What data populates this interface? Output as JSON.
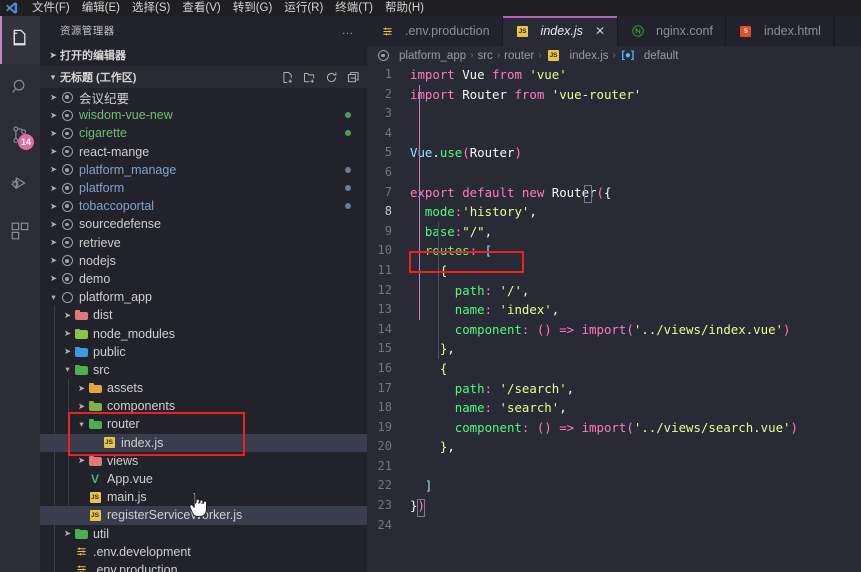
{
  "menu": {
    "logo_icon": "vscode-logo-icon",
    "items": [
      "文件(F)",
      "编辑(E)",
      "选择(S)",
      "查看(V)",
      "转到(G)",
      "运行(R)",
      "终端(T)",
      "帮助(H)"
    ]
  },
  "activitybar": {
    "items": [
      {
        "name": "explorer",
        "icon": "files-icon",
        "active": true,
        "badge": ""
      },
      {
        "name": "search",
        "icon": "search-icon",
        "active": false,
        "badge": ""
      },
      {
        "name": "source-control",
        "icon": "source-control-icon",
        "active": false,
        "badge": "14"
      },
      {
        "name": "run-debug",
        "icon": "run-and-debug-icon",
        "active": false,
        "badge": ""
      },
      {
        "name": "extensions",
        "icon": "extensions-icon",
        "active": false,
        "badge": ""
      }
    ]
  },
  "sidebar": {
    "title": "资源管理器",
    "more_actions": "…",
    "open_editors_label": "打开的编辑器",
    "workspace_label": "无标题 (工作区)",
    "actions": [
      "new-file-icon",
      "new-folder-icon",
      "refresh-icon",
      "collapse-all-icon"
    ],
    "tree": [
      {
        "label": "会议纪要",
        "depth": 1,
        "icon": "git-repo-icon",
        "chevron": "collapsed",
        "badge": ""
      },
      {
        "label": "wisdom-vue-new",
        "depth": 1,
        "icon": "git-repo-icon",
        "chevron": "collapsed",
        "badge": "#4a9e52",
        "color": "#6fbf73"
      },
      {
        "label": "cigarette",
        "depth": 1,
        "icon": "git-repo-icon",
        "chevron": "collapsed",
        "badge": "#4a9e52",
        "color": "#6fbf73"
      },
      {
        "label": "react-mange",
        "depth": 1,
        "icon": "git-repo-icon",
        "chevron": "collapsed",
        "badge": ""
      },
      {
        "label": "platform_manage",
        "depth": 1,
        "icon": "git-repo-icon",
        "chevron": "collapsed",
        "badge": "#6b7d94",
        "color": "#7fa3cc"
      },
      {
        "label": "platform",
        "depth": 1,
        "icon": "git-repo-icon",
        "chevron": "collapsed",
        "badge": "#6b7d94",
        "color": "#7fa3cc"
      },
      {
        "label": "tobaccoportal",
        "depth": 1,
        "icon": "git-repo-icon",
        "chevron": "collapsed",
        "badge": "#6b7d94",
        "color": "#7fa3cc"
      },
      {
        "label": "sourcedefense",
        "depth": 1,
        "icon": "git-repo-icon",
        "chevron": "collapsed",
        "badge": ""
      },
      {
        "label": "retrieve",
        "depth": 1,
        "icon": "git-repo-icon",
        "chevron": "collapsed",
        "badge": ""
      },
      {
        "label": "nodejs",
        "depth": 1,
        "icon": "git-repo-icon",
        "chevron": "collapsed",
        "badge": ""
      },
      {
        "label": "demo",
        "depth": 1,
        "icon": "git-repo-icon",
        "chevron": "collapsed",
        "badge": ""
      },
      {
        "label": "platform_app",
        "depth": 1,
        "icon": "open-circle-icon",
        "chevron": "expanded",
        "badge": ""
      },
      {
        "label": "dist",
        "depth": 2,
        "icon": "folder-icon",
        "folder_color": "#e07a7a",
        "chevron": "collapsed",
        "badge": ""
      },
      {
        "label": "node_modules",
        "depth": 2,
        "icon": "folder-icon",
        "folder_color": "#8bc34a",
        "chevron": "collapsed",
        "badge": ""
      },
      {
        "label": "public",
        "depth": 2,
        "icon": "folder-icon",
        "folder_color": "#3b9ae1",
        "chevron": "collapsed",
        "badge": ""
      },
      {
        "label": "src",
        "depth": 2,
        "icon": "folder-icon",
        "folder_color": "#4caf50",
        "chevron": "expanded",
        "badge": ""
      },
      {
        "label": "assets",
        "depth": 3,
        "icon": "folder-icon",
        "folder_color": "#e8a33d",
        "chevron": "collapsed",
        "badge": ""
      },
      {
        "label": "components",
        "depth": 3,
        "icon": "folder-icon",
        "folder_color": "#7cb342",
        "chevron": "collapsed",
        "badge": ""
      },
      {
        "label": "router",
        "depth": 3,
        "icon": "folder-icon",
        "folder_color": "#4caf50",
        "chevron": "expanded",
        "badge": ""
      },
      {
        "label": "index.js",
        "depth": 4,
        "icon": "js-file-icon",
        "chevron": "none",
        "badge": "",
        "selected": true
      },
      {
        "label": "views",
        "depth": 3,
        "icon": "folder-icon",
        "folder_color": "#e07a7a",
        "chevron": "collapsed",
        "badge": ""
      },
      {
        "label": "App.vue",
        "depth": 3,
        "icon": "vue-file-icon",
        "chevron": "none",
        "badge": ""
      },
      {
        "label": "main.js",
        "depth": 3,
        "icon": "js-file-icon",
        "chevron": "none",
        "badge": ""
      },
      {
        "label": "registerServiceWorker.js",
        "depth": 3,
        "icon": "js-file-icon",
        "chevron": "none",
        "badge": "",
        "hovered": true
      },
      {
        "label": "util",
        "depth": 2,
        "icon": "folder-icon",
        "folder_color": "#4caf50",
        "chevron": "collapsed",
        "badge": ""
      },
      {
        "label": ".env.development",
        "depth": 2,
        "icon": "settings-file-icon",
        "chevron": "none",
        "badge": ""
      },
      {
        "label": ".env.production",
        "depth": 2,
        "icon": "settings-file-icon",
        "chevron": "none",
        "badge": ""
      }
    ],
    "highlight_box_label": "router-index-js-highlight"
  },
  "editor": {
    "tabs": [
      {
        "label": ".env.production",
        "icon": "settings-file-icon",
        "active": false,
        "closable": false
      },
      {
        "label": "index.js",
        "icon": "js-file-icon",
        "active": true,
        "closable": true,
        "close_glyph": "✕"
      },
      {
        "label": "nginx.conf",
        "icon": "nginx-file-icon",
        "active": false,
        "closable": false
      },
      {
        "label": "index.html",
        "icon": "html-file-icon",
        "active": false,
        "closable": false
      }
    ],
    "breadcrumb": [
      {
        "label": "platform_app",
        "icon": "git-repo-icon"
      },
      {
        "label": "src",
        "icon": ""
      },
      {
        "label": "router",
        "icon": ""
      },
      {
        "label": "index.js",
        "icon": "js-file-icon"
      },
      {
        "label": "default",
        "icon": "symbol-default-icon"
      }
    ],
    "breadcrumb_separator": "›",
    "highlight_box_label": "base-line-highlight",
    "lines": [
      {
        "n": 1,
        "tokens": [
          {
            "t": "import ",
            "c": "t-kw"
          },
          {
            "t": "Vue ",
            "c": "t-plain"
          },
          {
            "t": "from ",
            "c": "t-kw"
          },
          {
            "t": "'vue'",
            "c": "t-str"
          }
        ]
      },
      {
        "n": 2,
        "tokens": [
          {
            "t": "import ",
            "c": "t-kw"
          },
          {
            "t": "Router ",
            "c": "t-plain"
          },
          {
            "t": "from ",
            "c": "t-kw"
          },
          {
            "t": "'vue-router'",
            "c": "t-str"
          }
        ]
      },
      {
        "n": 3,
        "tokens": []
      },
      {
        "n": 4,
        "tokens": []
      },
      {
        "n": 5,
        "tokens": [
          {
            "t": "Vue",
            "c": "t-cls"
          },
          {
            "t": ".",
            "c": "t-plain"
          },
          {
            "t": "use",
            "c": "t-fn"
          },
          {
            "t": "(",
            "c": "t-pun"
          },
          {
            "t": "Router",
            "c": "t-plain"
          },
          {
            "t": ")",
            "c": "t-pun"
          }
        ]
      },
      {
        "n": 6,
        "tokens": []
      },
      {
        "n": 7,
        "tokens": [
          {
            "t": "export default ",
            "c": "t-kw"
          },
          {
            "t": "new ",
            "c": "t-kw"
          },
          {
            "t": "Router",
            "c": "t-plain"
          },
          {
            "t": "(",
            "c": "t-pun"
          },
          {
            "t": "{",
            "c": "t-plain"
          }
        ]
      },
      {
        "n": 8,
        "tokens": [
          {
            "t": "  mode",
            "c": "t-prop"
          },
          {
            "t": ":",
            "c": "t-pun"
          },
          {
            "t": "'history'",
            "c": "t-str"
          },
          {
            "t": ",",
            "c": "t-plain"
          }
        ]
      },
      {
        "n": 9,
        "tokens": [
          {
            "t": "  base",
            "c": "t-prop"
          },
          {
            "t": ":",
            "c": "t-pun"
          },
          {
            "t": "\"/\"",
            "c": "t-str"
          },
          {
            "t": ",",
            "c": "t-plain"
          }
        ]
      },
      {
        "n": 10,
        "tokens": [
          {
            "t": "  routes",
            "c": "t-prop"
          },
          {
            "t": ": ",
            "c": "t-pun"
          },
          {
            "t": "[",
            "c": "t-cls"
          }
        ]
      },
      {
        "n": 11,
        "tokens": [
          {
            "t": "    ",
            "c": "t-plain"
          },
          {
            "t": "{",
            "c": "t-yel"
          }
        ]
      },
      {
        "n": 12,
        "tokens": [
          {
            "t": "      path",
            "c": "t-prop"
          },
          {
            "t": ": ",
            "c": "t-pun"
          },
          {
            "t": "'/'",
            "c": "t-str"
          },
          {
            "t": ",",
            "c": "t-plain"
          }
        ]
      },
      {
        "n": 13,
        "tokens": [
          {
            "t": "      name",
            "c": "t-prop"
          },
          {
            "t": ": ",
            "c": "t-pun"
          },
          {
            "t": "'index'",
            "c": "t-str"
          },
          {
            "t": ",",
            "c": "t-plain"
          }
        ]
      },
      {
        "n": 14,
        "tokens": [
          {
            "t": "      component",
            "c": "t-prop"
          },
          {
            "t": ": ",
            "c": "t-pun"
          },
          {
            "t": "()",
            "c": "t-pun"
          },
          {
            "t": " => ",
            "c": "t-kw"
          },
          {
            "t": "import",
            "c": "t-pun"
          },
          {
            "t": "(",
            "c": "t-pun"
          },
          {
            "t": "'../views/index.vue'",
            "c": "t-str"
          },
          {
            "t": ")",
            "c": "t-pun"
          }
        ]
      },
      {
        "n": 15,
        "tokens": [
          {
            "t": "    ",
            "c": "t-plain"
          },
          {
            "t": "}",
            "c": "t-yel"
          },
          {
            "t": ",",
            "c": "t-plain"
          }
        ]
      },
      {
        "n": 16,
        "tokens": [
          {
            "t": "    ",
            "c": "t-plain"
          },
          {
            "t": "{",
            "c": "t-yel"
          }
        ]
      },
      {
        "n": 17,
        "tokens": [
          {
            "t": "      path",
            "c": "t-prop"
          },
          {
            "t": ": ",
            "c": "t-pun"
          },
          {
            "t": "'/search'",
            "c": "t-str"
          },
          {
            "t": ",",
            "c": "t-plain"
          }
        ]
      },
      {
        "n": 18,
        "tokens": [
          {
            "t": "      name",
            "c": "t-prop"
          },
          {
            "t": ": ",
            "c": "t-pun"
          },
          {
            "t": "'search'",
            "c": "t-str"
          },
          {
            "t": ",",
            "c": "t-plain"
          }
        ]
      },
      {
        "n": 19,
        "tokens": [
          {
            "t": "      component",
            "c": "t-prop"
          },
          {
            "t": ": ",
            "c": "t-pun"
          },
          {
            "t": "()",
            "c": "t-pun"
          },
          {
            "t": " => ",
            "c": "t-kw"
          },
          {
            "t": "import",
            "c": "t-pun"
          },
          {
            "t": "(",
            "c": "t-pun"
          },
          {
            "t": "'../views/search.vue'",
            "c": "t-str"
          },
          {
            "t": ")",
            "c": "t-pun"
          }
        ]
      },
      {
        "n": 20,
        "tokens": [
          {
            "t": "    ",
            "c": "t-plain"
          },
          {
            "t": "}",
            "c": "t-yel"
          },
          {
            "t": ",",
            "c": "t-plain"
          }
        ]
      },
      {
        "n": 21,
        "tokens": []
      },
      {
        "n": 22,
        "tokens": [
          {
            "t": "  ",
            "c": "t-plain"
          },
          {
            "t": "]",
            "c": "t-cls"
          }
        ]
      },
      {
        "n": 23,
        "tokens": [
          {
            "t": "}",
            "c": "t-plain"
          },
          {
            "t": ")",
            "c": "t-pun"
          }
        ]
      },
      {
        "n": 24,
        "tokens": []
      }
    ]
  },
  "colors": {
    "accent": "#bd5fbd",
    "editor_bg": "#282a36",
    "sidebar_bg": "#22222a",
    "annotation_red": "#ee2020",
    "badge_pink": "#e06c9f"
  }
}
